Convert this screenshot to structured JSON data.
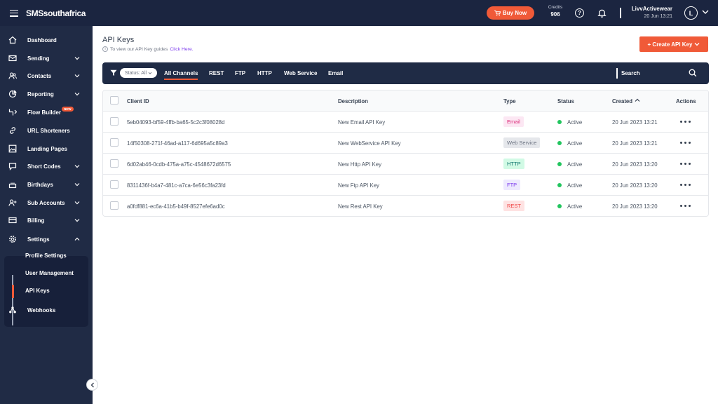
{
  "app": {
    "brand": "SMSsouthafrica"
  },
  "topbar": {
    "buy_now": "Buy Now",
    "credits_label": "Credits",
    "credits_value": "906",
    "help_glyph": "?",
    "username": "LivvActivewear",
    "datetime": "20 Jun 13:21",
    "avatar_initial": "L"
  },
  "sidebar": {
    "items": [
      {
        "label": "Dashboard",
        "icon": "home-icon"
      },
      {
        "label": "Sending",
        "icon": "mail-icon"
      },
      {
        "label": "Contacts",
        "icon": "users-icon"
      },
      {
        "label": "Reporting",
        "icon": "pie-chart-icon"
      },
      {
        "label": "Flow Builder",
        "icon": "flow-icon",
        "badge": "NEW"
      },
      {
        "label": "URL Shorteners",
        "icon": "link-icon"
      },
      {
        "label": "Landing Pages",
        "icon": "image-icon"
      },
      {
        "label": "Short Codes",
        "icon": "message-icon"
      },
      {
        "label": "Birthdays",
        "icon": "cake-icon"
      },
      {
        "label": "Sub Accounts",
        "icon": "user-plus-icon"
      },
      {
        "label": "Billing",
        "icon": "credit-card-icon"
      },
      {
        "label": "Settings",
        "icon": "gear-icon"
      },
      {
        "label": "Webhooks",
        "icon": "webhook-icon"
      }
    ],
    "settings_sub": [
      "Profile Settings",
      "User Management",
      "API Keys"
    ]
  },
  "main": {
    "title": "API Keys",
    "subtitle": "To view our API Key guides",
    "subtitle_link": "Click Here.",
    "create_button": "+ Create API Key"
  },
  "filters": {
    "status_pill": "Status: All",
    "tabs": [
      "All Channels",
      "REST",
      "FTP",
      "HTTP",
      "Web Service",
      "Email"
    ],
    "active_tab": "All Channels",
    "search_label": "Search"
  },
  "table": {
    "headers": {
      "client_id": "Client ID",
      "description": "Description",
      "type": "Type",
      "status": "Status",
      "created": "Created",
      "actions": "Actions"
    },
    "rows": [
      {
        "client_id": "5eb04093-bf59-4ffb-ba65-5c2c3f08028d",
        "description": "New Email API Key",
        "type": "Email",
        "status": "Active",
        "created": "20 Jun 2023 13:21"
      },
      {
        "client_id": "14f50308-271f-46ad-a117-6d695a5c89a3",
        "description": "New WebService API Key",
        "type": "Web Service",
        "status": "Active",
        "created": "20 Jun 2023 13:21"
      },
      {
        "client_id": "6d02ab46-0cdb-475a-a75c-4548672d6575",
        "description": "New Http API Key",
        "type": "HTTP",
        "status": "Active",
        "created": "20 Jun 2023 13:20"
      },
      {
        "client_id": "8311436f-b4a7-481c-a7ca-6e56c3fa23fd",
        "description": "New Ftp API Key",
        "type": "FTP",
        "status": "Active",
        "created": "20 Jun 2023 13:20"
      },
      {
        "client_id": "a0fdf881-ec6a-41b5-b49f-8527efe6ad0c",
        "description": "New Rest API Key",
        "type": "REST",
        "status": "Active",
        "created": "20 Jun 2023 13:20"
      }
    ]
  },
  "colors": {
    "accent": "#f05a38",
    "navy": "#1b2540",
    "active_status": "#22c55e",
    "type_email_bg": "#fce7f3",
    "type_email_fg": "#db2777",
    "type_webservice_bg": "#e5e7eb",
    "type_webservice_fg": "#6b7280",
    "type_http_bg": "#d1fae5",
    "type_http_fg": "#0f766e",
    "type_ftp_bg": "#ede9fe",
    "type_ftp_fg": "#7c3aed",
    "type_rest_bg": "#fee2e2",
    "type_rest_fg": "#ef4444"
  }
}
